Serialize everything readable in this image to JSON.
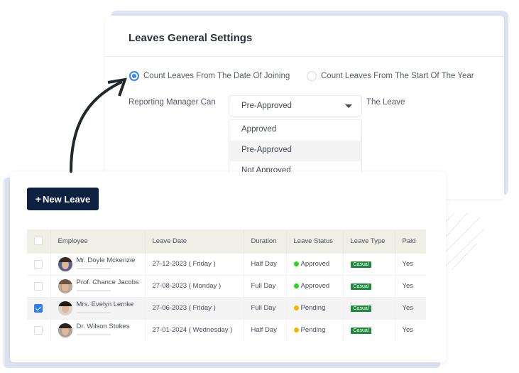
{
  "settings": {
    "title": "Leaves General Settings",
    "radio_options": [
      {
        "label": "Count Leaves From The Date Of Joining",
        "checked": true
      },
      {
        "label": "Count Leaves From The Start Of The Year",
        "checked": false
      }
    ],
    "reporting_label": "Reporting Manager Can",
    "select_value": "Pre-Approved",
    "suffix_label": "The Leave",
    "dropdown_options": [
      "Approved",
      "Pre-Approved",
      "Not Approved"
    ],
    "highlighted_option": "Pre-Approved",
    "accent_color": "#3b82f6"
  },
  "leaves": {
    "new_button": {
      "icon": "+",
      "label": "New Leave"
    },
    "columns": [
      "Employee",
      "Leave Date",
      "Duration",
      "Leave Status",
      "Leave Type",
      "Paid"
    ],
    "rows": [
      {
        "employee": "Mr. Doyle Mckenzie",
        "date": "27-12-2023 ( Friday )",
        "duration": "Half Day",
        "status": "Approved",
        "status_color": "#2bd41f",
        "type": "Casual",
        "paid": "Yes",
        "checked": false
      },
      {
        "employee": "Prof. Chance Jacobs",
        "date": "27-08-2023 ( Monday )",
        "duration": "Full Day",
        "status": "Approved",
        "status_color": "#2bd41f",
        "type": "Casual",
        "paid": "Yes",
        "checked": false
      },
      {
        "employee": "Mrs. Evelyn Lemke",
        "date": "27-06-2023 ( Friday )",
        "duration": "Full Day",
        "status": "Pending",
        "status_color": "#f7b500",
        "type": "Casual",
        "paid": "Yes",
        "checked": true
      },
      {
        "employee": "Dr. Wilson Stokes",
        "date": "27-01-2024 ( Wednesday )",
        "duration": "Half Day",
        "status": "Pending",
        "status_color": "#f7b500",
        "type": "Casual",
        "paid": "Yes",
        "checked": false
      }
    ],
    "button_color": "#0c2142",
    "badge_color": "#1f8a3e"
  }
}
